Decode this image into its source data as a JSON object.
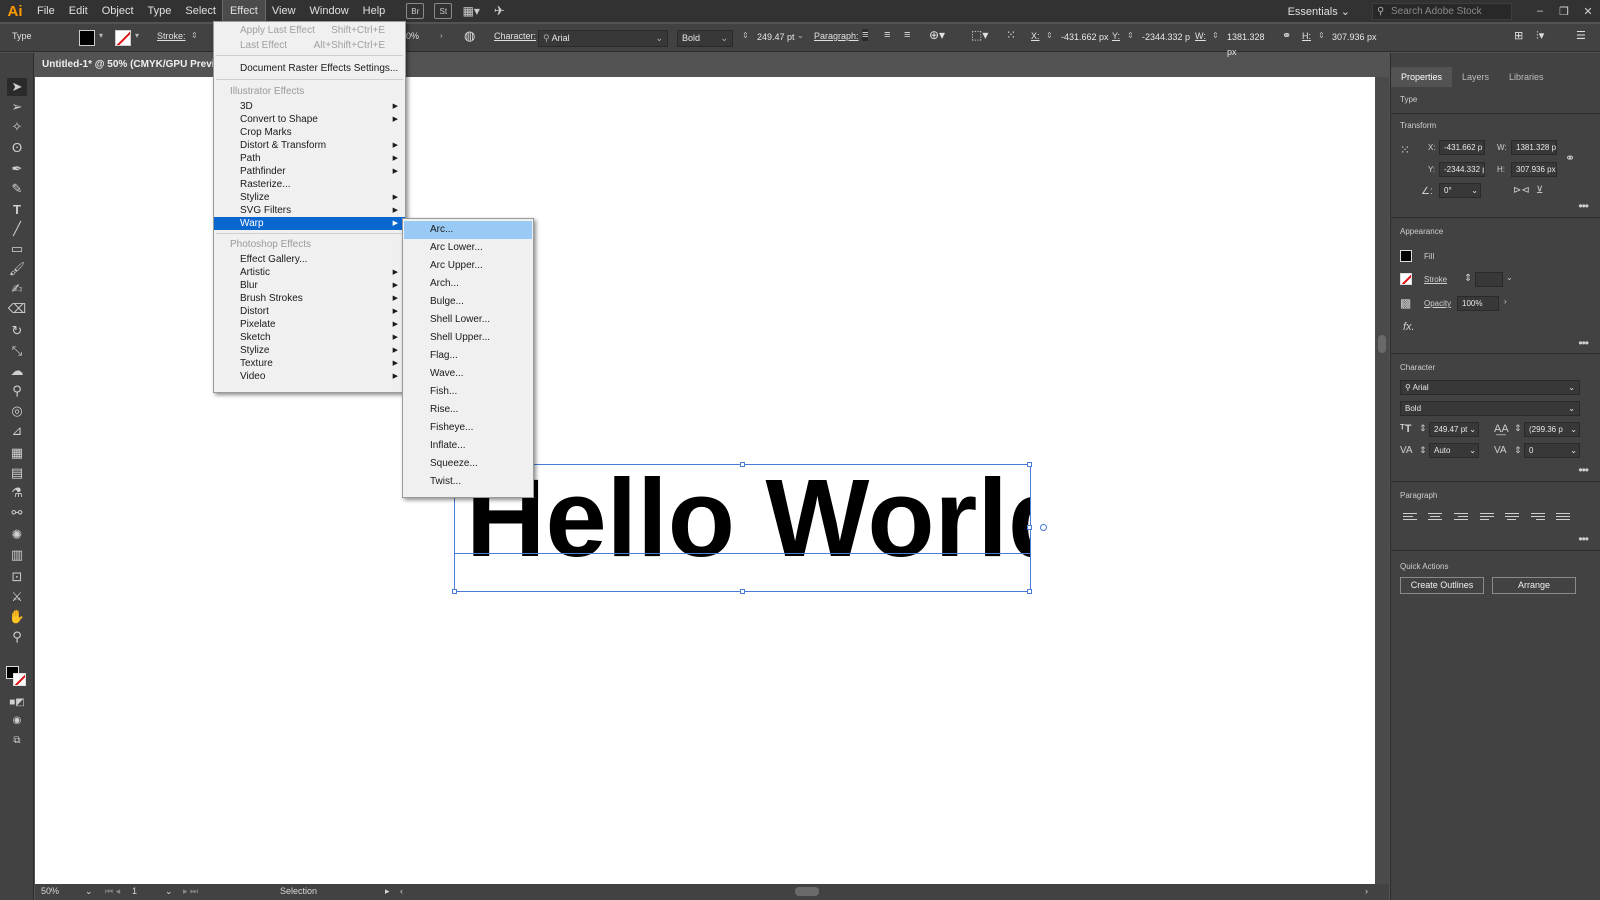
{
  "app": {
    "logo": "Ai",
    "accent": "#ff9a00"
  },
  "menubar": {
    "items": [
      "File",
      "Edit",
      "Object",
      "Type",
      "Select",
      "Effect",
      "View",
      "Window",
      "Help"
    ],
    "bridge_label": "St",
    "workspace": "Essentials",
    "search_placeholder": "Search Adobe Stock"
  },
  "controlbar": {
    "selection_type": "Type",
    "stroke_label": "Stroke:",
    "opacity_partial": "0%",
    "character_label": "Character:",
    "font_name": "Arial",
    "font_style": "Bold",
    "font_size": "249.47 pt",
    "paragraph_label": "Paragraph:",
    "x_label": "X:",
    "x_value": "-431.662 px",
    "y_label": "Y:",
    "y_value": "-2344.332 p",
    "w_label": "W:",
    "w_value": "1381.328 px",
    "h_label": "H:",
    "h_value": "307.936 px"
  },
  "document": {
    "tab_title": "Untitled-1* @ 50% (CMYK/GPU Preview)",
    "artwork_text": "Hello World"
  },
  "statusbar": {
    "zoom": "50%",
    "artboard": "1",
    "tool": "Selection"
  },
  "effect_menu": {
    "apply_last": "Apply Last Effect",
    "apply_last_shortcut": "Shift+Ctrl+E",
    "last_effect": "Last Effect",
    "last_effect_shortcut": "Alt+Shift+Ctrl+E",
    "raster_settings": "Document Raster Effects Settings...",
    "illustrator_header": "Illustrator Effects",
    "illustrator_items": [
      "3D",
      "Convert to Shape",
      "Crop Marks",
      "Distort & Transform",
      "Path",
      "Pathfinder",
      "Rasterize...",
      "Stylize",
      "SVG Filters",
      "Warp"
    ],
    "photoshop_header": "Photoshop Effects",
    "photoshop_items": [
      "Effect Gallery...",
      "Artistic",
      "Blur",
      "Brush Strokes",
      "Distort",
      "Pixelate",
      "Sketch",
      "Stylize",
      "Texture",
      "Video"
    ]
  },
  "warp_menu": {
    "items": [
      "Arc...",
      "Arc Lower...",
      "Arc Upper...",
      "Arch...",
      "Bulge...",
      "Shell Lower...",
      "Shell Upper...",
      "Flag...",
      "Wave...",
      "Fish...",
      "Rise...",
      "Fisheye...",
      "Inflate...",
      "Squeeze...",
      "Twist..."
    ]
  },
  "panel": {
    "tabs": [
      "Properties",
      "Layers",
      "Libraries"
    ],
    "type_label": "Type",
    "transform_header": "Transform",
    "x_label": "X:",
    "x_value": "-431.662 p",
    "w_label": "W:",
    "w_value": "1381.328 p",
    "y_label": "Y:",
    "y_value": "-2344.332 p",
    "h_label": "H:",
    "h_value": "307.936 px",
    "angle_value": "0°",
    "appearance_header": "Appearance",
    "fill_label": "Fill",
    "stroke_label": "Stroke",
    "opacity_label": "Opacity",
    "opacity_value": "100%",
    "fx_label": "fx.",
    "character_header": "Character",
    "font_name": "Arial",
    "font_style": "Bold",
    "font_size": "249.47 pt",
    "leading": "(299.36 p",
    "kerning": "Auto",
    "tracking": "0",
    "paragraph_header": "Paragraph",
    "quick_actions_header": "Quick Actions",
    "create_outlines": "Create Outlines",
    "arrange": "Arrange"
  }
}
